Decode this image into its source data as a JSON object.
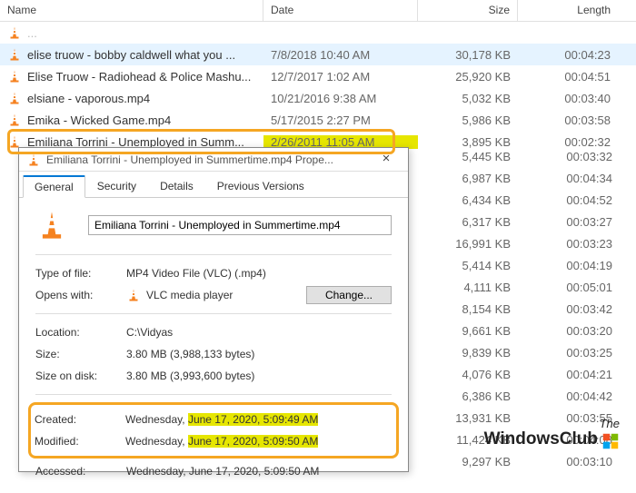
{
  "columns": {
    "name": "Name",
    "date": "Date",
    "size": "Size",
    "length": "Length"
  },
  "rows_top": [
    {
      "name": "elise truow - bobby caldwell what you ...",
      "date": "7/8/2018 10:40 AM",
      "size": "30,178 KB",
      "length": "00:04:23",
      "hover": true
    },
    {
      "name": "Elise Truow - Radiohead & Police Mashu...",
      "date": "12/7/2017 1:02 AM",
      "size": "25,920 KB",
      "length": "00:04:51"
    },
    {
      "name": "elsiane - vaporous.mp4",
      "date": "10/21/2016 9:38 AM",
      "size": "5,032 KB",
      "length": "00:03:40"
    },
    {
      "name": "Emika - Wicked Game.mp4",
      "date": "5/17/2015 2:27 PM",
      "size": "5,986 KB",
      "length": "00:03:58"
    }
  ],
  "row_hl": {
    "name": "Emiliana Torrini - Unemployed in Summ...",
    "date": "2/26/2011 11:05 AM",
    "size": "3,895 KB",
    "length": "00:02:32"
  },
  "rows_side": [
    {
      "size": "5,445 KB",
      "length": "00:03:32"
    },
    {
      "size": "6,987 KB",
      "length": "00:04:34"
    },
    {
      "size": "6,434 KB",
      "length": "00:04:52"
    },
    {
      "size": "6,317 KB",
      "length": "00:03:27"
    },
    {
      "size": "16,991 KB",
      "length": "00:03:23"
    },
    {
      "size": "5,414 KB",
      "length": "00:04:19"
    },
    {
      "size": "4,111 KB",
      "length": "00:05:01"
    },
    {
      "size": "8,154 KB",
      "length": "00:03:42"
    },
    {
      "size": "9,661 KB",
      "length": "00:03:20"
    },
    {
      "size": "9,839 KB",
      "length": "00:03:25"
    },
    {
      "size": "4,076 KB",
      "length": "00:04:21"
    },
    {
      "size": "6,386 KB",
      "length": "00:04:42"
    },
    {
      "size": "13,931 KB",
      "length": "00:03:55"
    },
    {
      "size": "11,424 KB",
      "length": "00:04:08"
    },
    {
      "size": "9,297 KB",
      "length": "00:03:10"
    }
  ],
  "props": {
    "title": "Emiliana Torrini - Unemployed in Summertime.mp4 Prope...",
    "tabs": {
      "general": "General",
      "security": "Security",
      "details": "Details",
      "prev": "Previous Versions"
    },
    "filename": "Emiliana Torrini - Unemployed in Summertime.mp4",
    "type_of_file_k": "Type of file:",
    "type_of_file_v": "MP4 Video File (VLC) (.mp4)",
    "opens_with_k": "Opens with:",
    "opens_with_v": "VLC media player",
    "change_btn": "Change...",
    "location_k": "Location:",
    "location_v": "C:\\Vidyas",
    "size_k": "Size:",
    "size_v": "3.80 MB (3,988,133 bytes)",
    "size_on_disk_k": "Size on disk:",
    "size_on_disk_v": "3.80 MB (3,993,600 bytes)",
    "created_k": "Created:",
    "created_pre": "Wednesday, ",
    "created_hl": "June 17, 2020, 5:09:49 AM",
    "modified_k": "Modified:",
    "modified_pre": "Wednesday, ",
    "modified_hl": "June 17, 2020, 5:09:50 AM",
    "accessed_k": "Accessed:",
    "accessed_v": "Wednesday, June 17, 2020, 5:09:50 AM"
  },
  "watermark": {
    "line1": "The",
    "line2": "WindowsClub"
  }
}
